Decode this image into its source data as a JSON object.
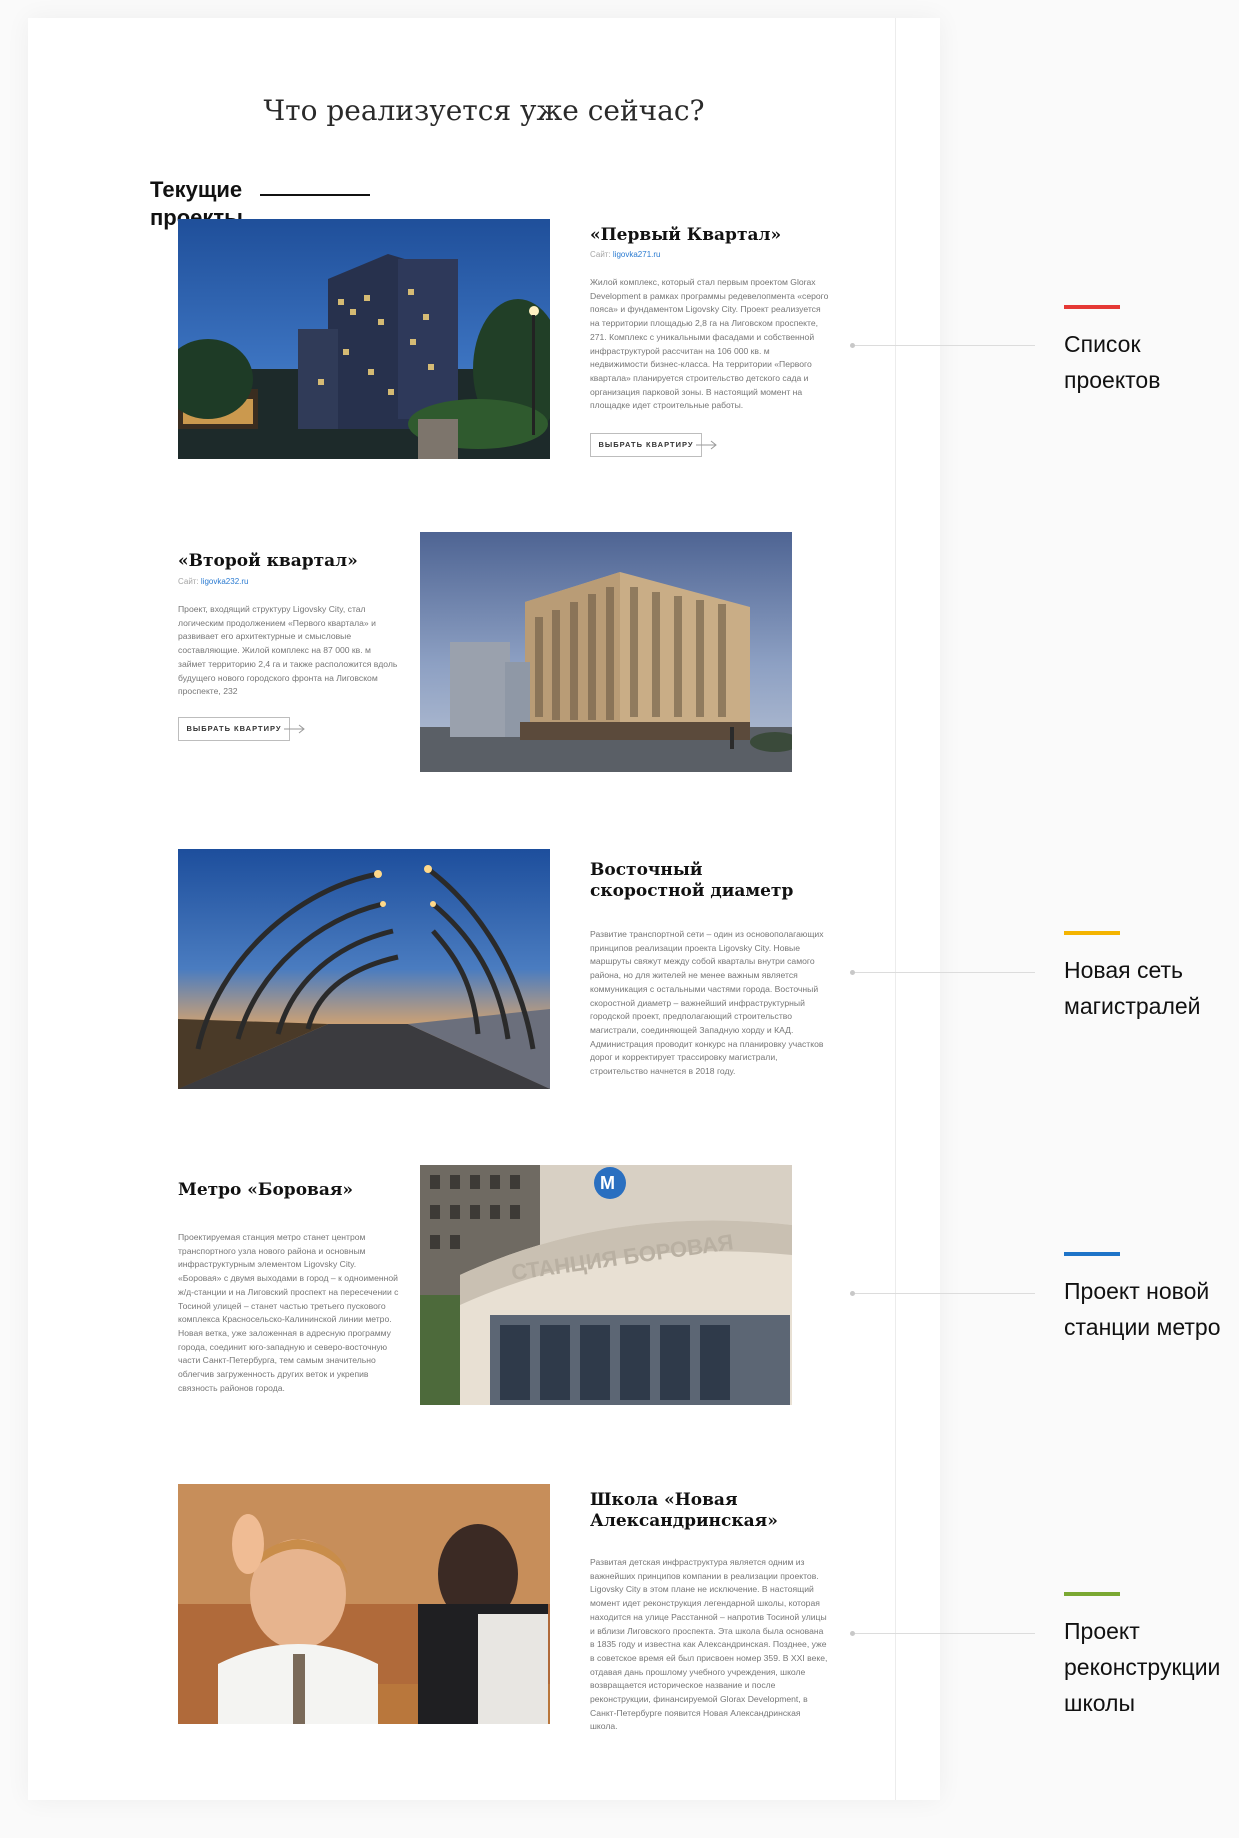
{
  "title": "Что реализуется уже сейчас?",
  "side_label": "Текущие проекты",
  "projects": [
    {
      "title": "«Первый Квартал»",
      "site_label": "Сайт:",
      "site_link": "ligovka271.ru",
      "description": "Жилой комплекс, который стал первым проектом Glorax Development в рамках программы редевелопмента «серого пояса» и фундаментом Ligovsky City. Проект реализуется на территории площадью 2,8 га на Лиговском проспекте, 271. Комплекс с уникальными фасадами и собственной инфраструктурой рассчитан на 106 000 кв. м недвижимости бизнес-класса. На территории «Первого квартала» планируется строительство детского сада и организация парковой зоны. В настоящий момент на площадке идет строительные работы.",
      "button": "ВЫБРАТЬ КВАРТИРУ",
      "image": "evening-residential-complex"
    },
    {
      "title": "«Второй квартал»",
      "site_label": "Сайт:",
      "site_link": "ligovka232.ru",
      "description": "Проект, входящий структуру Ligovsky City, стал логическим продолжением «Первого квартала» и развивает его архитектурные и смысловые составляющие. Жилой комплекс на 87 000 кв. м займет территорию 2,4 га и также расположится вдоль будущего нового городского фронта на Лиговском проспекте, 232",
      "button": "ВЫБРАТЬ КВАРТИРУ",
      "image": "beige-apartment-building"
    },
    {
      "title": "Восточный скоростной диаметр",
      "description": "Развитие транспортной сети – один из основополагающих принципов реализации проекта Ligovsky City. Новые маршруты свяжут между собой кварталы внутри самого района, но для жителей не менее важным является коммуникация с остальными частями города. Восточный скоростной диаметр – важнейший инфраструктурный городской проект, предполагающий строительство магистрали, соединяющей Западную хорду и КАД. Администрация проводит конкурс на планировку участков дорог и корректирует трассировку магистрали, строительство начнется в 2018 году.",
      "image": "highway-with-lamps"
    },
    {
      "title": "Метро «Боровая»",
      "description": "Проектируемая станция метро станет центром транспортного узла нового района и основным инфраструктурным элементом Ligovsky City. «Боровая» с двумя выходами в город – к одноименной ж/д-станции и на Лиговский проспект на пересечении с Тосиной улицей – станет частью третьего пускового комплекса Красносельско-Калининской линии метро. Новая ветка, уже заложенная в адресную программу города, соединит юго-западную и северо-восточную части Санкт-Петербурга, тем самым значительно облегчив загруженность других веток и укрепив связность районов города.",
      "image": "metro-station",
      "sign": "СТАНЦИЯ БОРОВАЯ"
    },
    {
      "title": "Школа «Новая Александринская»",
      "description": "Развитая детская инфраструктура является одним из важнейших принципов компании в реализации проектов. Ligovsky City в этом плане не исключение. В настоящий момент идет реконструкция легендарной школы, которая находится на улице Расстанной – напротив Тосиной улицы и вблизи Лиговского проспекта. Эта школа была основана в 1835 году и известна как Александринская. Позднее, уже в советское время ей был присвоен номер 359. В XXI веке, отдавая дань прошлому учебного учреждения, школе возвращается историческое название и после реконструкции, финансируемой Glorax Development, в Санкт-Петербурге появится Новая Александринская школа.",
      "image": "schoolboy-raising-hand"
    }
  ],
  "annotations": [
    {
      "label": "Список проектов",
      "color": "#e53935"
    },
    {
      "label": "Новая сеть магистралей",
      "color": "#f4b400"
    },
    {
      "label": "Проект новой станции метро",
      "color": "#1e74c8"
    },
    {
      "label": "Проект реконструкции школы",
      "color": "#7aa832"
    }
  ]
}
